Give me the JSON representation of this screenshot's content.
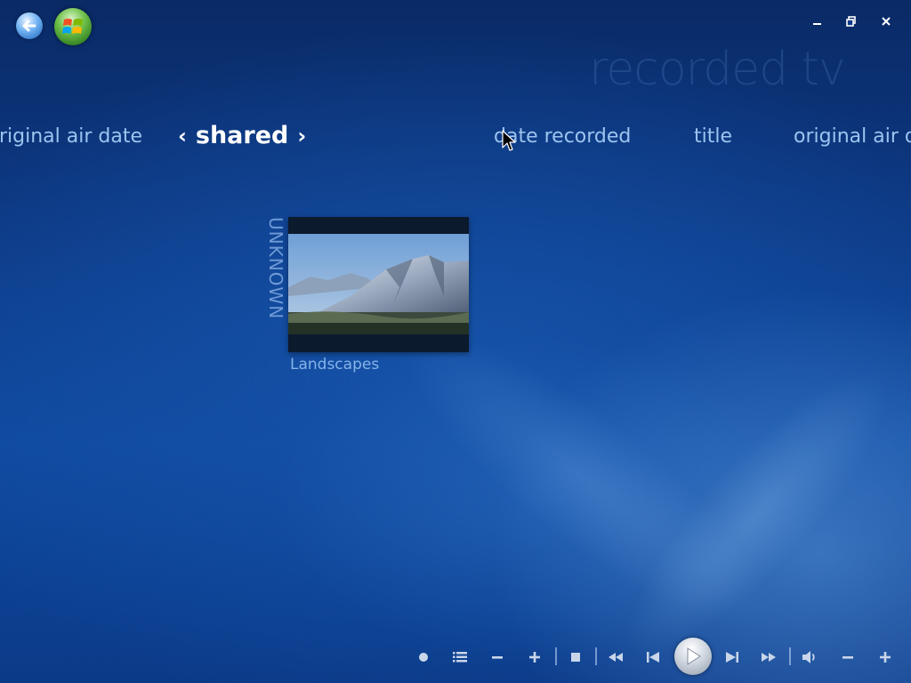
{
  "app": {
    "section_title": "recorded tv"
  },
  "header": {
    "back_icon": "back-arrow-icon",
    "start_icon": "windows-logo-icon",
    "window_controls": {
      "minimize": "minimize-icon",
      "restore": "restore-icon",
      "close": "close-icon"
    }
  },
  "pivots": {
    "left_partial": "original air date",
    "current": "shared",
    "items": [
      "date recorded",
      "title",
      "original air date"
    ]
  },
  "library": {
    "group_label": "UNKNOWN",
    "tiles": [
      {
        "caption": "Landscapes",
        "thumbnail": "mountain-landscape"
      }
    ]
  },
  "transport": {
    "buttons": [
      "record",
      "guide",
      "channel-down",
      "channel-up",
      "stop",
      "rewind",
      "previous",
      "play",
      "next",
      "fast-forward",
      "mute",
      "volume-down",
      "volume-up"
    ]
  },
  "colors": {
    "background": "#0f4aa0",
    "pivot_text": "#9cc4f0",
    "active_text": "#ffffff",
    "caption_text": "#86b3ea"
  }
}
